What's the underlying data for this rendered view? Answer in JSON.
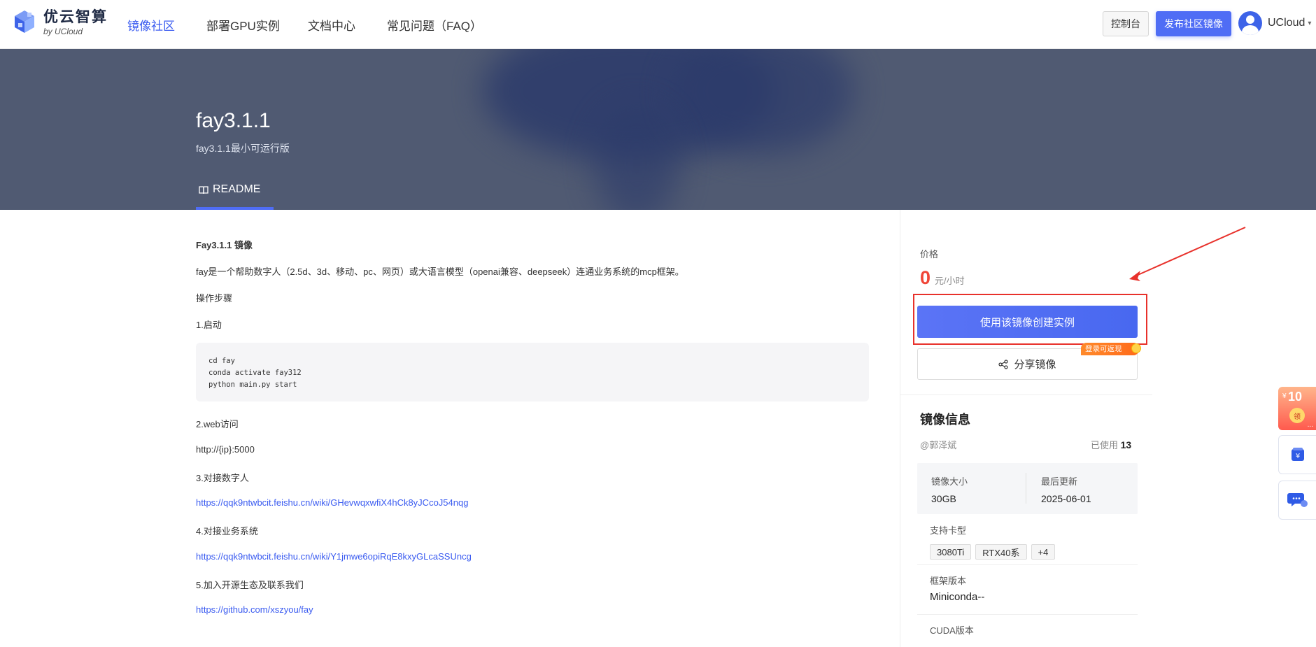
{
  "header": {
    "logo_main": "优云智算",
    "logo_sub": "by UCloud",
    "nav": [
      {
        "label": "镜像社区",
        "active": true
      },
      {
        "label": "部署GPU实例",
        "active": false
      },
      {
        "label": "文档中心",
        "active": false
      },
      {
        "label": "常见问题（FAQ）",
        "active": false
      }
    ],
    "console_label": "控制台",
    "publish_label": "发布社区镜像",
    "user_name": "UCloud"
  },
  "hero": {
    "title": "fay3.1.1",
    "subtitle": "fay3.1.1最小可运行版",
    "tab_label": "README"
  },
  "readme": {
    "heading": "Fay3.1.1 镜像",
    "intro": "fay是一个帮助数字人（2.5d、3d、移动、pc、网页）或大语言模型（openai兼容、deepseek）连通业务系统的mcp框架。",
    "steps_title": "操作步骤",
    "step1": "1.启动",
    "code_lines": [
      "cd fay",
      "conda activate fay312",
      "python main.py start"
    ],
    "step2": "2.web访问",
    "web_url": "http://{ip}:5000",
    "step3": "3.对接数字人",
    "link3": "https://qqk9ntwbcit.feishu.cn/wiki/GHevwqxwfiX4hCk8yJCcoJ54nqg",
    "step4": "4.对接业务系统",
    "link4": "https://qqk9ntwbcit.feishu.cn/wiki/Y1jmwe6opiRqE8kxyGLcaSSUncg",
    "step5": "5.加入开源生态及联系我们",
    "link5": "https://github.com/xszyou/fay"
  },
  "panel": {
    "price_label": "价格",
    "price_value": "0",
    "price_unit": "元/小时",
    "create_label": "使用该镜像创建实例",
    "share_label": "分享镜像",
    "login_badge": "登录可返现",
    "info_title": "镜像信息",
    "author": "@郭泽斌",
    "usage_label": "已使用",
    "usage_count": "13",
    "size_label": "镜像大小",
    "size_value": "30GB",
    "updated_label": "最后更新",
    "updated_value": "2025-06-01",
    "cards_label": "支持卡型",
    "cards": [
      "3080Ti",
      "RTX40系",
      "+4"
    ],
    "framework_label": "框架版本",
    "framework_value": "Miniconda--",
    "cuda_label": "CUDA版本"
  },
  "floating": {
    "gift_amount": "10",
    "gift_prefix": "¥",
    "gift_seal": "领",
    "gift_dots": "..."
  },
  "colors": {
    "accent": "#4f6df5",
    "price_red": "#f04638",
    "annotation_red": "#e8312b",
    "hero_bg": "#505a72"
  }
}
